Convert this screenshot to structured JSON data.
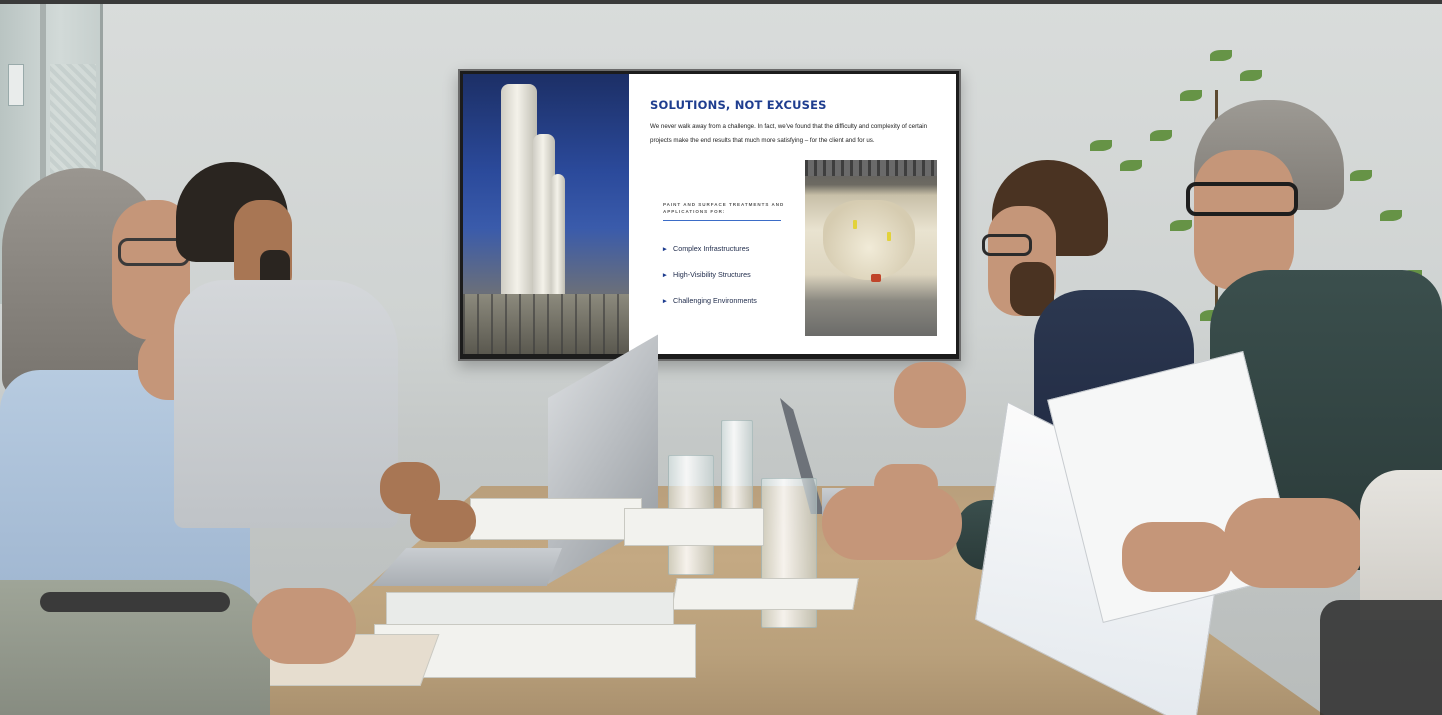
{
  "presentation": {
    "title": "SOLUTIONS, NOT EXCUSES",
    "body": "We never walk away from a challenge. In fact, we've found that the difficulty and complexity of certain projects make the end results that much more satisfying – for the client and for us.",
    "subheading": "PAINT AND SURFACE TREATMENTS AND APPLICATIONS FOR:",
    "bullets": [
      "Complex Infrastructures",
      "High-Visibility Structures",
      "Challenging Environments"
    ],
    "bullet_icon": "chevron-right-icon",
    "accent_color": "#1e3d8f"
  }
}
